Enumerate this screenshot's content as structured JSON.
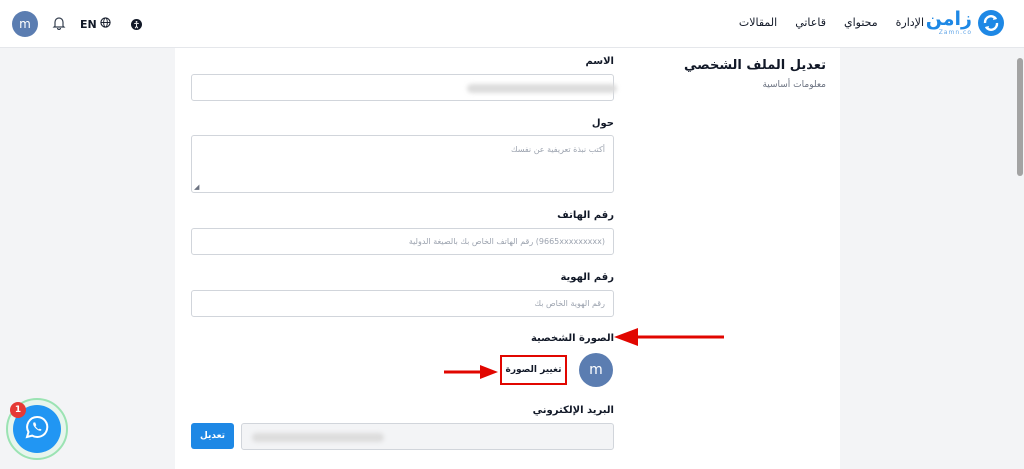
{
  "header": {
    "logo": {
      "name": "زامن",
      "sub": "Zamn.co"
    },
    "nav": [
      "الإدارة",
      "محتواي",
      "قاعاتي",
      "المقالات"
    ],
    "lang": "EN",
    "avatar_initial": "m"
  },
  "sidebar": {
    "title": "تعديل الملف الشخصي",
    "subtitle": "معلومات أساسية"
  },
  "form": {
    "name": {
      "label": "الاسم",
      "value": ""
    },
    "about": {
      "label": "حول",
      "placeholder": "أكتب نبذة تعريفية عن نفسك"
    },
    "phone": {
      "label": "رقم الهاتف",
      "placeholder": "(9665xxxxxxxxx) رقم الهاتف الخاص بك بالصيغة الدولية"
    },
    "id_number": {
      "label": "رقم الهوية",
      "placeholder": "رقم الهوية الخاص بك"
    },
    "photo": {
      "label": "الصورة الشخصية",
      "avatar_initial": "m",
      "change_button": "تغيير الصورة"
    },
    "email": {
      "label": "البريد الإلكتروني",
      "edit_button": "تعديل"
    }
  },
  "whatsapp": {
    "badge_count": "1"
  },
  "colors": {
    "brand": "#1e88e5",
    "annotation": "#e10600",
    "avatar": "#5b7db1",
    "whatsapp": "#2196f3"
  },
  "icons": [
    "bell-icon",
    "globe-icon",
    "accessibility-icon",
    "whatsapp-icon",
    "resize-grip-icon"
  ]
}
